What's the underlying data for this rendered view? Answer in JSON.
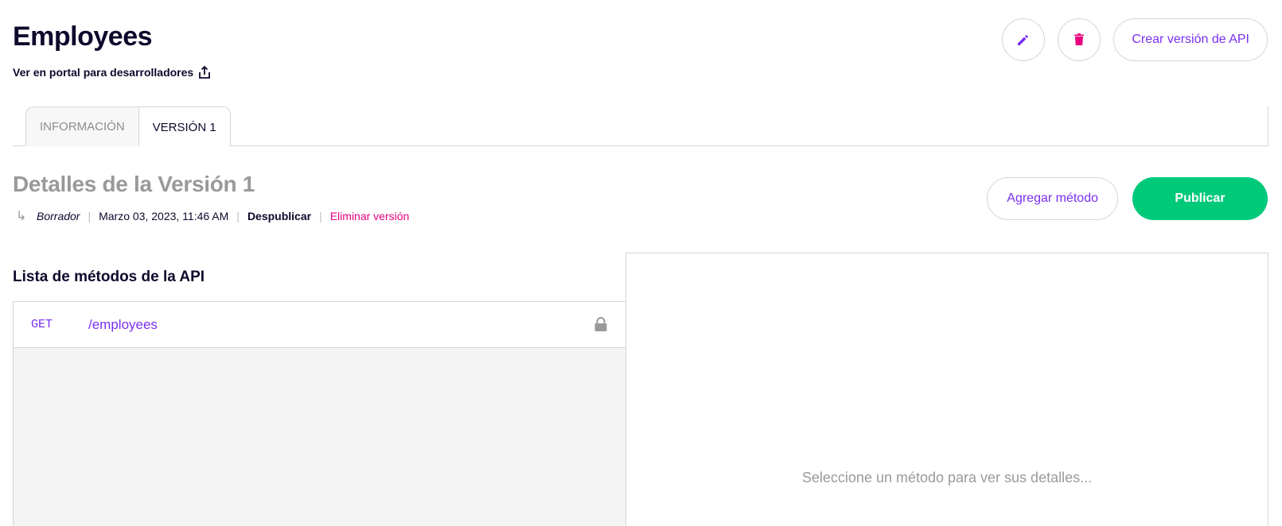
{
  "header": {
    "title": "Employees",
    "portal_link": "Ver en portal para desarrolladores",
    "create_version_label": "Crear versión de API"
  },
  "tabs": [
    {
      "label": "INFORMACIÓN",
      "active": false
    },
    {
      "label": "VERSIÓN 1",
      "active": true
    }
  ],
  "version": {
    "title": "Detalles de la Versión 1",
    "status": "Borrador",
    "date": "Marzo 03, 2023, 11:46 AM",
    "unpublish_label": "Despublicar",
    "delete_label": "Eliminar versión",
    "add_method_label": "Agregar método",
    "publish_label": "Publicar"
  },
  "methods": {
    "heading": "Lista de métodos de la API",
    "items": [
      {
        "verb": "GET",
        "path": "/employees"
      }
    ]
  },
  "details": {
    "placeholder": "Seleccione un método para ver sus detalles..."
  },
  "colors": {
    "accent": "#7a2ff2",
    "danger": "#e6007e",
    "success": "#00c97a",
    "text": "#0d0a2c"
  }
}
